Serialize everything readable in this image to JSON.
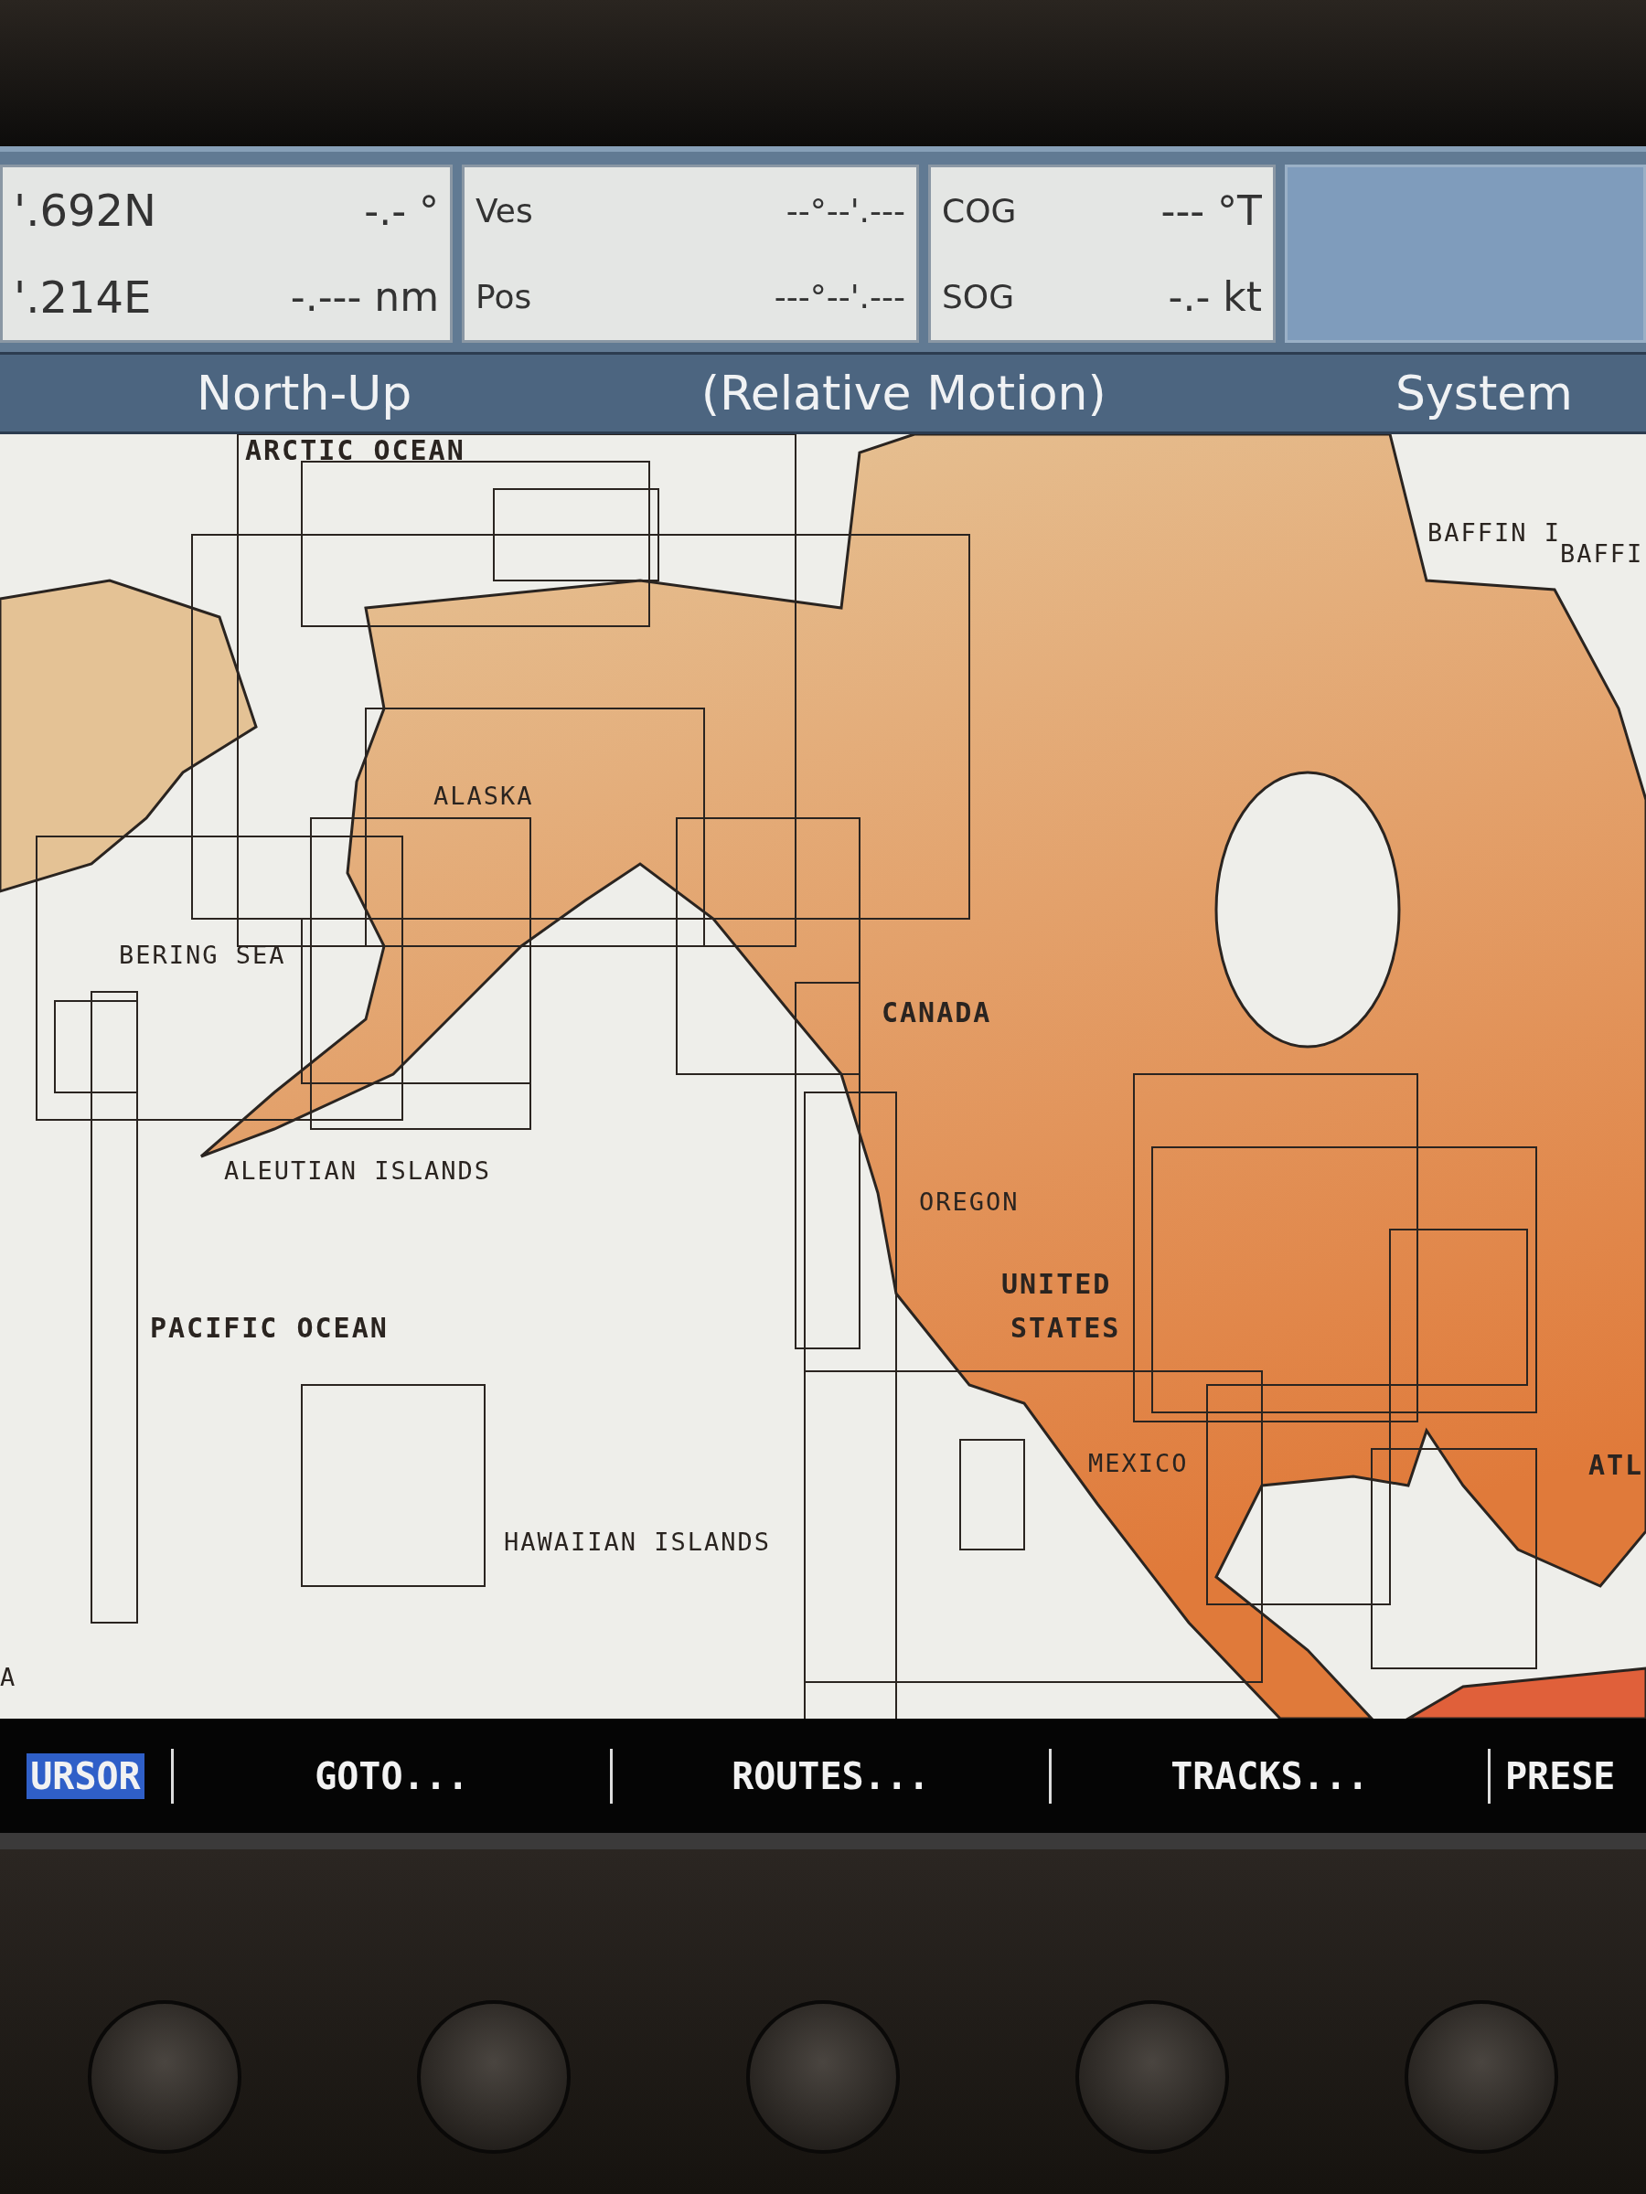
{
  "info_panels": [
    {
      "rows": [
        {
          "label": "'.692N",
          "value": "-.- °"
        },
        {
          "label": "'.214E",
          "value": "-.--- nm"
        }
      ]
    },
    {
      "rows": [
        {
          "label": "Ves",
          "value": "--°--'.---"
        },
        {
          "label": "Pos",
          "value": "---°--'.---"
        }
      ]
    },
    {
      "rows": [
        {
          "label": "COG",
          "value": "--- °T"
        },
        {
          "label": "SOG",
          "value": "-.- kt"
        }
      ]
    }
  ],
  "mode_bar": {
    "orientation": "North-Up",
    "motion": "(Relative Motion)",
    "source": "System"
  },
  "map": {
    "labels": [
      {
        "text": "ARCTIC OCEAN",
        "kind": "bold"
      },
      {
        "text": "BAFFIN I",
        "kind": "plain"
      },
      {
        "text": "BAFFI",
        "kind": "plain"
      },
      {
        "text": "ALASKA",
        "kind": "plain"
      },
      {
        "text": "BERING SEA",
        "kind": "plain"
      },
      {
        "text": "ALEUTIAN ISLANDS",
        "kind": "plain"
      },
      {
        "text": "CANADA",
        "kind": "bold"
      },
      {
        "text": "OREGON",
        "kind": "plain"
      },
      {
        "text": "UNITED",
        "kind": "bold"
      },
      {
        "text": "STATES",
        "kind": "bold"
      },
      {
        "text": "PACIFIC OCEAN",
        "kind": "bold"
      },
      {
        "text": "HAWAIIAN ISLANDS",
        "kind": "plain"
      },
      {
        "text": "MEXICO",
        "kind": "plain"
      },
      {
        "text": "ATL",
        "kind": "bold"
      },
      {
        "text": "A",
        "kind": "plain"
      }
    ]
  },
  "softkeys": [
    {
      "label": "URSOR",
      "selected": true
    },
    {
      "label": "GOTO...",
      "selected": false
    },
    {
      "label": "ROUTES...",
      "selected": false
    },
    {
      "label": "TRACKS...",
      "selected": false
    },
    {
      "label": "PRESE",
      "selected": false
    }
  ]
}
